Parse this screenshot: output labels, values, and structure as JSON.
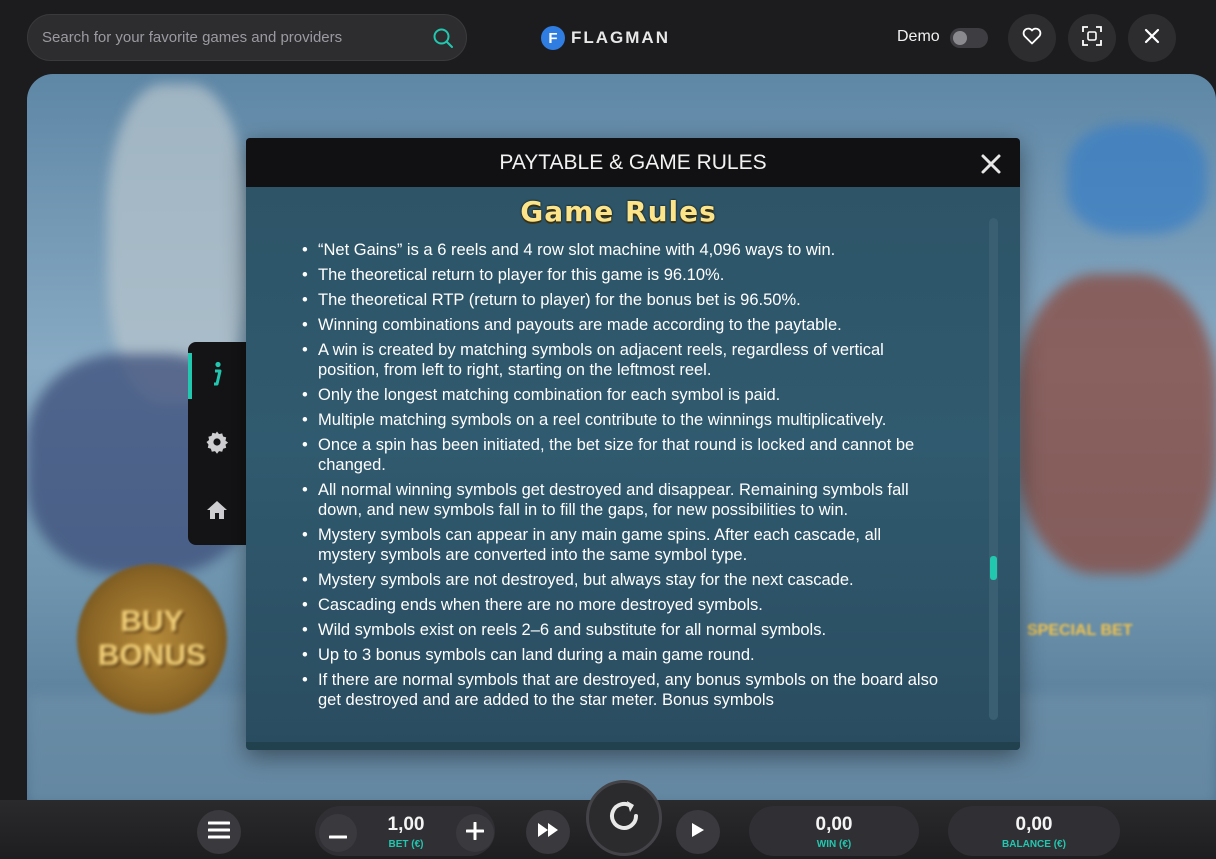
{
  "header": {
    "search_placeholder": "Search for your favorite games and providers",
    "logo_letter": "F",
    "logo_text": "FLAGMAN",
    "demo_label": "Demo",
    "demo_enabled": false
  },
  "game_bg": {
    "buy_bonus_line1": "BUY",
    "buy_bonus_line2": "BONUS",
    "special_bet_label": "SPECIAL BET"
  },
  "side_menu": {
    "active_item": "info"
  },
  "modal": {
    "title": "PAYTABLE & GAME RULES",
    "heading": "Game Rules",
    "rules": [
      "“Net Gains” is a 6 reels and 4 row slot machine with 4,096 ways to win.",
      "The theoretical return to player for this game is 96.10%.",
      "The theoretical RTP (return to player) for the bonus bet is 96.50%.",
      "Winning combinations and payouts are made according to the paytable.",
      "A win is created by matching symbols on adjacent reels, regardless of vertical position, from left to right, starting on the leftmost reel.",
      "Only the longest matching combination for each symbol is paid.",
      "Multiple matching symbols on a reel contribute to the winnings multiplicatively.",
      "Once a spin has been initiated, the bet size for that round is locked and cannot be changed.",
      "All normal winning symbols get destroyed and disappear. Remaining symbols fall down, and new symbols fall in to fill the gaps, for new possibilities to win.",
      "Mystery symbols can appear in any main game spins. After each cascade, all mystery symbols are converted into the same symbol type.",
      "Mystery symbols are not destroyed, but always stay for the next cascade.",
      "Cascading ends when there are no more destroyed symbols.",
      "Wild symbols exist on reels 2–6 and substitute for all normal symbols.",
      "Up to 3 bonus symbols can land during a main game round.",
      "If there are normal symbols that are destroyed, any bonus symbols on the board also get destroyed and are added to the star meter. Bonus symbols"
    ]
  },
  "controls": {
    "bet_value": "1,00",
    "bet_label": "BET (€)",
    "win_value": "0,00",
    "win_label": "WIN (€)",
    "balance_value": "0,00",
    "balance_label": "BALANCE (€)"
  },
  "colors": {
    "accent": "#22c7b0",
    "heading": "#fbe48a",
    "logo_blue": "#2f7de1"
  }
}
